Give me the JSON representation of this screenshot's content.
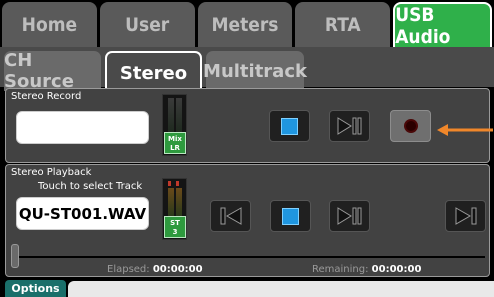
{
  "top_tabs": [
    "Home",
    "User",
    "Meters",
    "RTA",
    "USB Audio"
  ],
  "sub_tabs": [
    "CH Source",
    "Stereo",
    "Multitrack"
  ],
  "record": {
    "title": "Stereo Record",
    "meter_label_line1": "Mix",
    "meter_label_line2": "LR"
  },
  "playback": {
    "title": "Stereo Playback",
    "hint": "Touch to select Track",
    "track_name": "QU-ST001.WAV",
    "meter_label_line1": "ST",
    "meter_label_line2": "3",
    "elapsed_label": "Elapsed:",
    "elapsed_value": "00:00:00",
    "remaining_label": "Remaining:",
    "remaining_value": "00:00:00"
  },
  "footer": {
    "options_label": "Options"
  },
  "colors": {
    "accent_green": "#2fb04a",
    "button_blue": "#1f96e0",
    "arrow_orange": "#f0872a"
  }
}
